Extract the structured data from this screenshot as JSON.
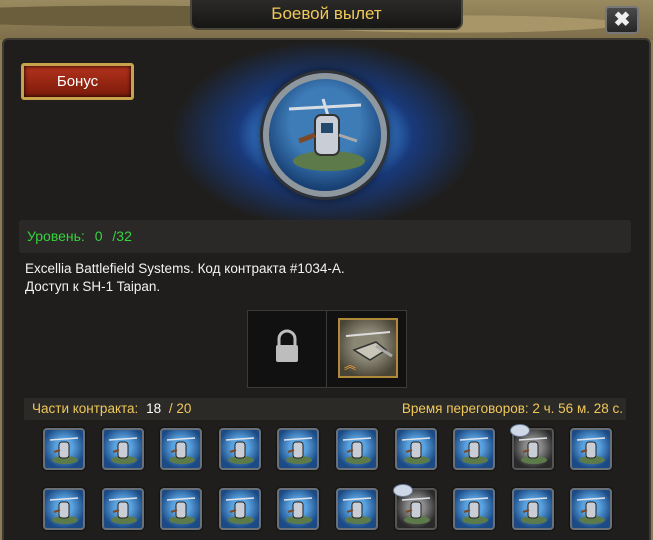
{
  "window": {
    "title": "Боевой вылет",
    "close_label": "✖"
  },
  "bonus_button": {
    "label": "Бонус"
  },
  "emblem": {
    "icon": "helicopter-emblem"
  },
  "level": {
    "label": "Уровень:",
    "current": "0",
    "max": "/32"
  },
  "description": {
    "line1": "Excellia Battlefield Systems. Код контракта #1034-A.",
    "line2": "Доступ к SH-1 Taipan."
  },
  "reward_slots": [
    {
      "icon": "lock-icon"
    },
    {
      "icon": "helicopter-unit-icon"
    }
  ],
  "contract": {
    "parts_label": "Части контракта:",
    "parts_current": "18",
    "parts_total": "/ 20",
    "negotiation_label": "Время переговоров: 2 ч. 56 м. 28 с."
  },
  "pieces": {
    "row1": [
      "collected",
      "collected",
      "collected",
      "collected",
      "collected",
      "collected",
      "collected",
      "collected",
      "missing",
      "collected"
    ],
    "row2": [
      "collected",
      "collected",
      "collected",
      "collected",
      "collected",
      "collected",
      "missing",
      "collected",
      "collected",
      "collected"
    ]
  },
  "colors": {
    "accent": "#f0c85a",
    "level_green": "#37d23e",
    "bonus_red": "#b3321c"
  }
}
